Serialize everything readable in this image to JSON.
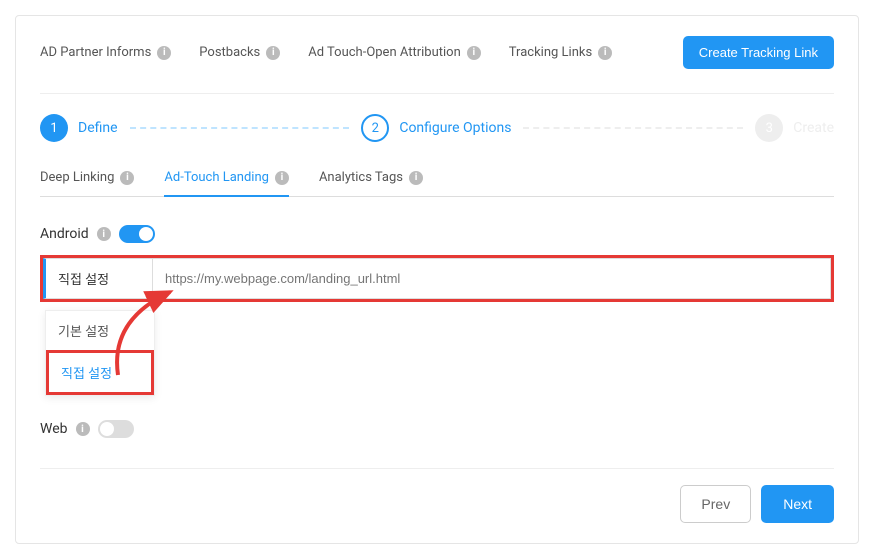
{
  "topNav": {
    "items": [
      {
        "label": "AD Partner Informs"
      },
      {
        "label": "Postbacks"
      },
      {
        "label": "Ad Touch-Open Attribution"
      },
      {
        "label": "Tracking Links"
      }
    ],
    "createBtn": "Create Tracking Link"
  },
  "stepper": {
    "steps": [
      {
        "num": "1",
        "label": "Define"
      },
      {
        "num": "2",
        "label": "Configure Options"
      },
      {
        "num": "3",
        "label": "Create"
      }
    ]
  },
  "subTabs": [
    {
      "label": "Deep Linking",
      "active": false
    },
    {
      "label": "Ad-Touch Landing",
      "active": true
    },
    {
      "label": "Analytics Tags",
      "active": false
    }
  ],
  "android": {
    "label": "Android",
    "toggleOn": true,
    "selectValue": "직접 설정",
    "inputPlaceholder": "https://my.webpage.com/landing_url.html",
    "dropdown": {
      "option1": "기본 설정",
      "option2": "직접 설정"
    }
  },
  "web": {
    "label": "Web",
    "toggleOn": false
  },
  "footer": {
    "prev": "Prev",
    "next": "Next"
  }
}
